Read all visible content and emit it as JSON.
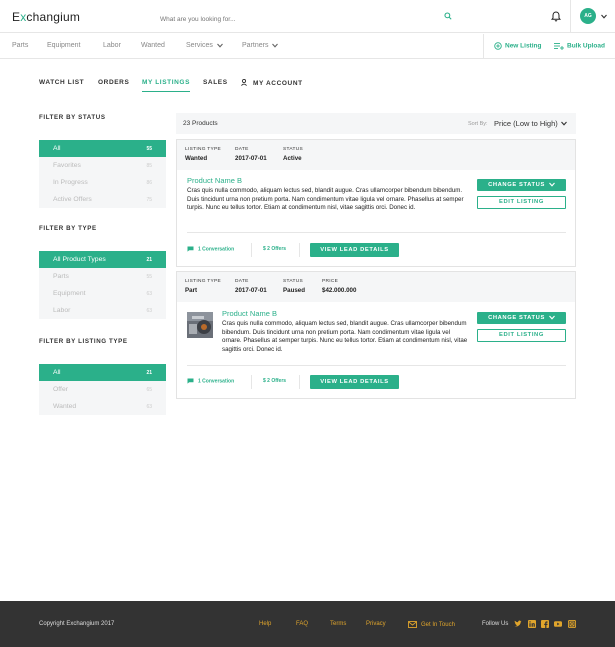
{
  "header": {
    "logo_prefix": "E",
    "logo_x": "x",
    "logo_suffix": "changium",
    "search_placeholder": "What are you looking for...",
    "avatar_initials": "AG"
  },
  "catnav": {
    "items": [
      "Parts",
      "Equipment",
      "Labor",
      "Wanted",
      "Services",
      "Partners"
    ],
    "new_listing": "New Listing",
    "bulk_upload": "Bulk Upload"
  },
  "tabs": [
    "WATCH LIST",
    "ORDERS",
    "MY LISTINGS",
    "SALES",
    "MY ACCOUNT"
  ],
  "active_tab": "MY LISTINGS",
  "filters": [
    {
      "title": "FILTER BY STATUS",
      "rows": [
        {
          "label": "All",
          "count": "55",
          "selected": true
        },
        {
          "label": "Favorites",
          "count": "85",
          "selected": false
        },
        {
          "label": "In Progress",
          "count": "86",
          "selected": false
        },
        {
          "label": "Active Offers",
          "count": "75",
          "selected": false
        }
      ]
    },
    {
      "title": "FILTER BY TYPE",
      "rows": [
        {
          "label": "All Product Types",
          "count": "21",
          "selected": true
        },
        {
          "label": "Parts",
          "count": "55",
          "selected": false
        },
        {
          "label": "Equipment",
          "count": "63",
          "selected": false
        },
        {
          "label": "Labor",
          "count": "63",
          "selected": false
        }
      ]
    },
    {
      "title": "FILTER BY LISTING TYPE",
      "rows": [
        {
          "label": "All",
          "count": "21",
          "selected": true
        },
        {
          "label": "Offer",
          "count": "65",
          "selected": false
        },
        {
          "label": "Wanted",
          "count": "63",
          "selected": false
        }
      ]
    }
  ],
  "results": {
    "count_text": "23 Products",
    "sort_label": "Sort By:",
    "sort_value": "Price (Low to High)"
  },
  "listings": [
    {
      "meta": [
        {
          "label": "LISTING TYPE",
          "value": "Wanted"
        },
        {
          "label": "DATE",
          "value": "2017-07-01"
        },
        {
          "label": "STATUS",
          "value": "Active"
        }
      ],
      "product_name": "Product Name B",
      "description": "Cras quis nulla commodo, aliquam lectus sed, blandit augue. Cras ullamcorper bibendum bibendum. Duis tincidunt urna non pretium porta. Nam condimentum vitae ligula vel ornare. Phasellus at semper turpis. Nunc eu tellus tortor. Etiam at condimentum nisl, vitae sagittis orci. Donec id.",
      "change_status": "CHANGE STATUS",
      "edit_listing": "EDIT LISTING",
      "conversations": "1 Conversation",
      "offers": "$ 2 Offers",
      "view_lead": "VIEW LEAD DETAILS",
      "has_image": false
    },
    {
      "meta": [
        {
          "label": "LISTING TYPE",
          "value": "Part"
        },
        {
          "label": "DATE",
          "value": "2017-07-01"
        },
        {
          "label": "STATUS",
          "value": "Paused"
        },
        {
          "label": "PRICE",
          "value": "$42.000.000"
        }
      ],
      "product_name": "Product Name B",
      "description": "Cras quis nulla commodo, aliquam lectus sed, blandit augue. Cras ullamcorper bibendum bibendum. Duis tincidunt urna non pretium porta. Nam condimentum vitae ligula vel ornare. Phasellus at semper turpis. Nunc eu tellus tortor. Etiam at condimentum nisl, vitae sagittis orci. Donec id.",
      "change_status": "CHANGE STATUS",
      "edit_listing": "EDIT LISTING",
      "conversations": "1 Conversation",
      "offers": "$ 2 Offers",
      "view_lead": "VIEW LEAD DETAILS",
      "has_image": true
    }
  ],
  "footer": {
    "copyright": "Copyright Exchangium 2017",
    "links": [
      "Help",
      "FAQ",
      "Terms",
      "Privacy"
    ],
    "get_in_touch": "Get In Touch",
    "follow_us": "Follow Us",
    "socials": [
      "twitter-icon",
      "linkedin-icon",
      "facebook-icon",
      "youtube-icon",
      "instagram-icon"
    ]
  },
  "colors": {
    "accent": "#2bb08a",
    "footer_bg": "#333333",
    "footer_link": "#e0a52c",
    "panel_bg": "#f5f6f7"
  }
}
